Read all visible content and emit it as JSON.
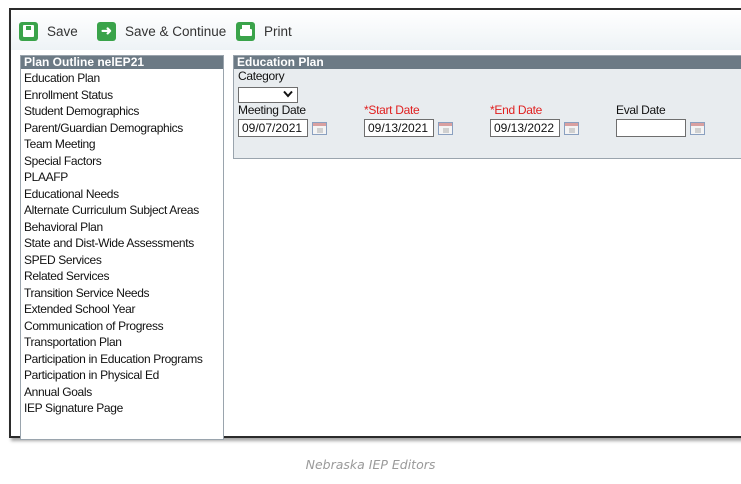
{
  "toolbar": {
    "save_label": "Save",
    "save_continue_label": "Save & Continue",
    "print_label": "Print"
  },
  "outline": {
    "title": "Plan Outline nelEP21",
    "items": [
      "Education Plan",
      "Enrollment Status",
      "Student Demographics",
      "Parent/Guardian Demographics",
      "Team Meeting",
      "Special Factors",
      "PLAAFP",
      "Educational Needs",
      "Alternate Curriculum Subject Areas",
      "Behavioral Plan",
      "State and Dist-Wide Assessments",
      "SPED Services",
      "Related Services",
      "Transition Service Needs",
      "Extended School Year",
      "Communication of Progress",
      "Transportation Plan",
      "Participation in Education Programs",
      "Participation in Physical Ed",
      "Annual Goals",
      "IEP Signature Page"
    ]
  },
  "plan": {
    "title": "Education Plan",
    "category_label": "Category",
    "category_value": "",
    "meeting_date_label": "Meeting Date",
    "meeting_date_value": "09/07/2021",
    "start_date_label": "*Start Date",
    "start_date_value": "09/13/2021",
    "end_date_label": "*End Date",
    "end_date_value": "09/13/2022",
    "eval_date_label": "Eval Date",
    "eval_date_value": ""
  },
  "caption": "Nebraska IEP Editors",
  "colors": {
    "accent_green": "#3aa34a",
    "panel_header": "#6c7a85",
    "panel_bg": "#e8ecef",
    "required_label": "#e02020",
    "caption": "#9a9a9a"
  },
  "icons": [
    "save-icon",
    "arrow-right-icon",
    "printer-icon",
    "chevron-down-icon",
    "calendar-icon"
  ]
}
